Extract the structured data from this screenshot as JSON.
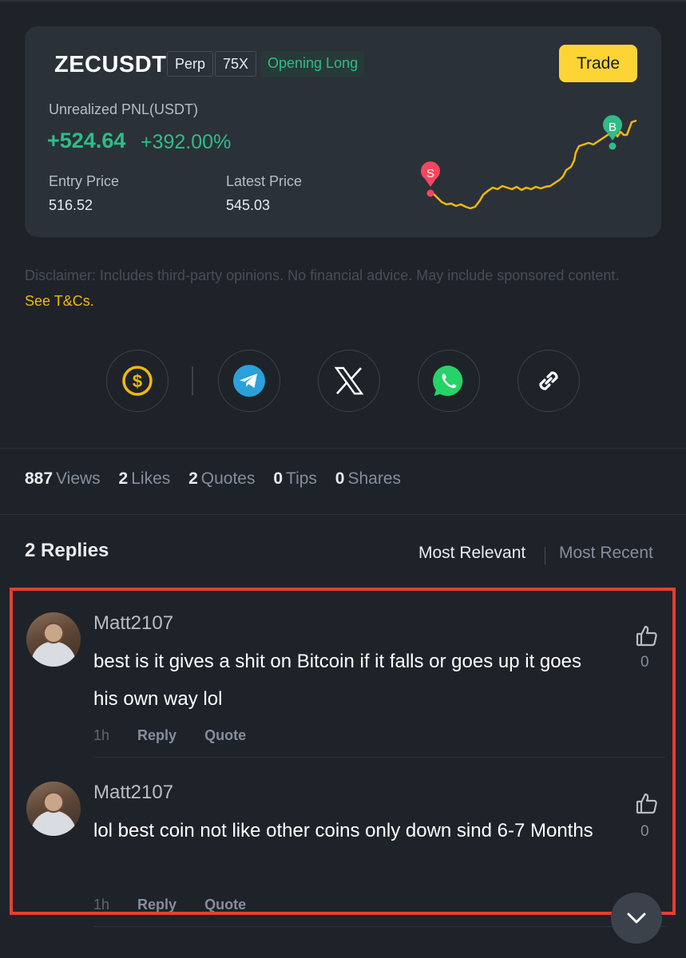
{
  "position_card": {
    "symbol": "ZECUSDT",
    "type_tag": "Perp",
    "leverage_tag": "75X",
    "status_tag": "Opening Long",
    "trade_button": "Trade",
    "pnl_label": "Unrealized PNL(USDT)",
    "pnl_value": "+524.64",
    "pnl_percent": "+392.00%",
    "entry_price_label": "Entry Price",
    "entry_price": "516.52",
    "latest_price_label": "Latest Price",
    "latest_price": "545.03",
    "chart_sell_marker": "S",
    "chart_buy_marker": "B",
    "colors": {
      "positive": "#2ebd85",
      "accent": "#fcd535",
      "sell": "#f6465d",
      "line": "#f0b90b"
    }
  },
  "disclaimer": {
    "text": "Disclaimer: Includes third-party opinions. No financial advice. May include sponsored content.",
    "link": "See T&Cs."
  },
  "share": {
    "items": [
      {
        "icon": "dollar-tip-icon"
      },
      {
        "icon": "telegram-icon"
      },
      {
        "icon": "x-icon"
      },
      {
        "icon": "whatsapp-icon"
      },
      {
        "icon": "link-icon"
      }
    ]
  },
  "stats": {
    "views_count": "887",
    "views_label": "Views",
    "likes_count": "2",
    "likes_label": "Likes",
    "quotes_count": "2",
    "quotes_label": "Quotes",
    "tips_count": "0",
    "tips_label": "Tips",
    "shares_count": "0",
    "shares_label": "Shares"
  },
  "replies": {
    "title": "2 Replies",
    "sort_relevant": "Most Relevant",
    "sort_recent": "Most Recent",
    "items": [
      {
        "username": "Matt2107",
        "text": "best is it gives a shit on Bitcoin if it falls or goes up it goes his own way lol",
        "time": "1h",
        "reply_label": "Reply",
        "quote_label": "Quote",
        "likes": "0"
      },
      {
        "username": "Matt2107",
        "text": "lol best coin not like other coins only down sind 6-7 Months",
        "time": "1h",
        "reply_label": "Reply",
        "quote_label": "Quote",
        "likes": "0"
      }
    ]
  }
}
